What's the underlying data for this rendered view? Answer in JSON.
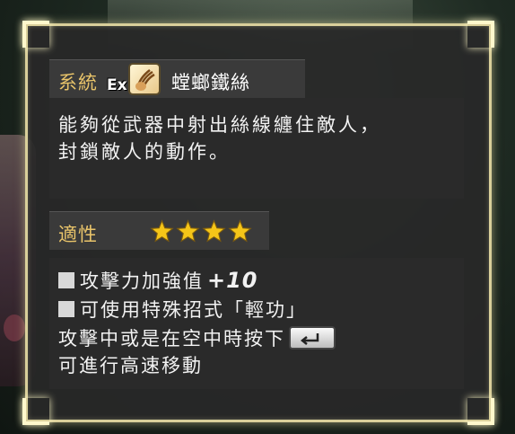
{
  "system": {
    "label": "系統",
    "ex_label": "Ex",
    "icon": "claw-icon",
    "skill_name": "螳螂鐵絲"
  },
  "description": {
    "lines": [
      "能夠從武器中射出絲線纏住敵人，",
      "封鎖敵人的動作。"
    ]
  },
  "aptitude": {
    "label": "適性",
    "stars": 4
  },
  "effects": {
    "line1": "攻擊力加強值",
    "line1_value": "+10",
    "line2": "可使用特殊招式「輕功」",
    "line3": "攻擊中或是在空中時按下",
    "line3_button": "return-button-icon",
    "line4": "可進行高速移動"
  },
  "colors": {
    "label_gold": "#e9c46a",
    "star_gold": "#f5c518",
    "frame": "#d9cf9a"
  }
}
